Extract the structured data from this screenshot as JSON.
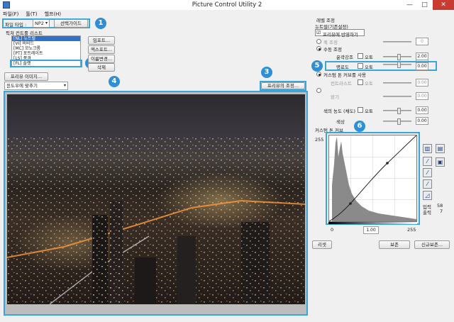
{
  "window": {
    "title": "Picture Control Utility 2",
    "minimize": "—",
    "maximize": "□",
    "close": "✕"
  },
  "menu": [
    "파일(F)",
    "툴(T)",
    "헬프(H)"
  ],
  "file_type": {
    "label": "파일 타입 :",
    "value": "NP2",
    "guide_button": "선택가이드"
  },
  "badges": {
    "b1": "1",
    "b2": "2",
    "b3": "3",
    "b4": "4",
    "b5": "5",
    "b6": "6"
  },
  "picture_control_list": {
    "title": "픽쳐 컨트롤 리스트",
    "items": [
      "[NL] 뉴트럴",
      "[VI] 비비드",
      "[MC] 모노크롬",
      "[PT] 포트레이트",
      "[LS] 풍경",
      "[FL] 플랫"
    ],
    "selected_index": 0,
    "highlighted_index": 5,
    "buttons": [
      "임포트...",
      "엑스포트...",
      "이름변경...",
      "삭제"
    ]
  },
  "preview": {
    "image_button": "프리뷰 이미지...",
    "fit_select": "윈도우에 맞추기",
    "adjust_button": "프리뷰의 조정..."
  },
  "level_adjust": {
    "title": "레벨 조정",
    "base_label": "뉴트럴(기존설정)",
    "apply_preview": "프리뷰에 반영하기",
    "quick_adjust": "퀵 조정",
    "manual_adjust": "수동 조정",
    "sharpness": {
      "label": "윤곽강조",
      "auto": "오토",
      "value": "2.00"
    },
    "clarity": {
      "label": "",
      "auto": "",
      "value": "0.00"
    },
    "brightness_row": {
      "label": "명료도",
      "auto": "오토",
      "value": "0.00"
    },
    "use_custom_curve": "커스텀 톤 커브를 사용",
    "contrast": {
      "label": "컨트라스트",
      "auto": "오토",
      "value": "0.00"
    },
    "brightness": {
      "label": "밝기",
      "value": "0.00"
    },
    "saturation": {
      "label": "색의 농도 (채도)",
      "auto": "오토",
      "value": "0.00"
    },
    "hue": {
      "label": "색상",
      "value": "0.00"
    }
  },
  "custom_curve": {
    "title": "커스텀 톤 커브",
    "y_max": "255",
    "x_min": "0",
    "x_mid": "1.00",
    "x_max": "255",
    "input_label": "입력",
    "input_value": "58",
    "output_label": "출력",
    "output_value": "7"
  },
  "footer": {
    "reset": "리셋",
    "save": "보존",
    "save_new": "신규보존..."
  }
}
